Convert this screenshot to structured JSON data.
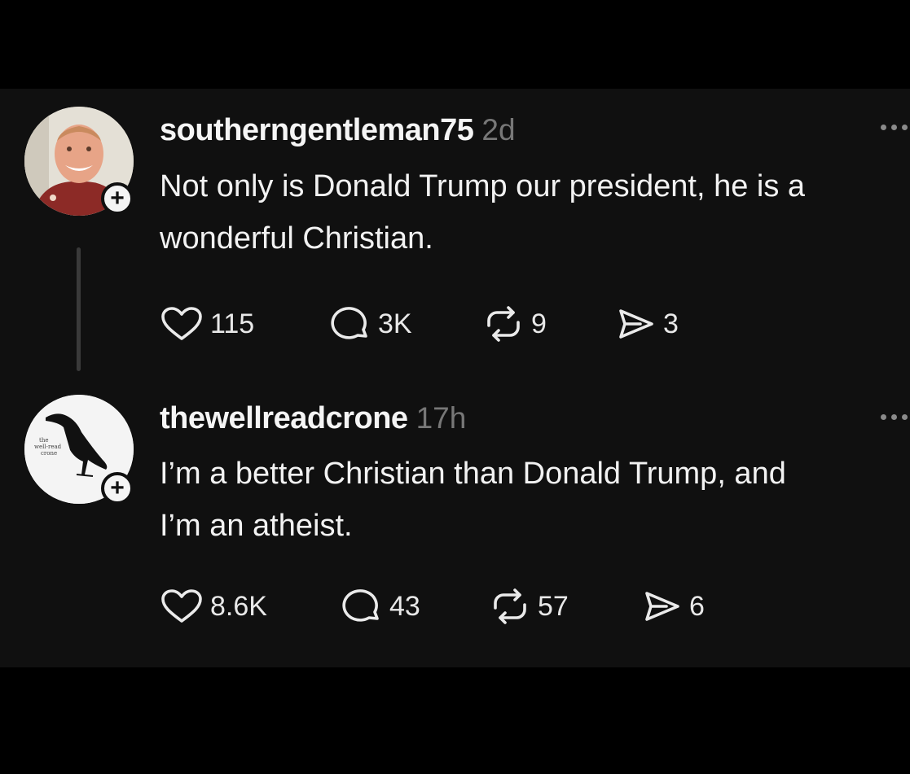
{
  "posts": [
    {
      "username": "southerngentleman75",
      "timestamp": "2d",
      "text": "Not only is Donald Trump our president, he is a\nwonderful Christian.",
      "likes": "115",
      "replies": "3K",
      "reposts": "9",
      "shares": "3"
    },
    {
      "username": "thewellreadcrone",
      "timestamp": "17h",
      "avatar_logo_text": "the well-read crone",
      "text": "I’m a better Christian than Donald Trump, and\nI’m an atheist.",
      "likes": "8.6K",
      "replies": "43",
      "reposts": "57",
      "shares": "6"
    }
  ],
  "follow_badge": "+",
  "icons": {
    "like": "heart-icon",
    "reply": "comment-icon",
    "repost": "repost-icon",
    "share": "send-icon",
    "more": "more-icon"
  },
  "colors": {
    "background": "#101010",
    "text": "#f3f3f3",
    "muted": "#777777"
  }
}
